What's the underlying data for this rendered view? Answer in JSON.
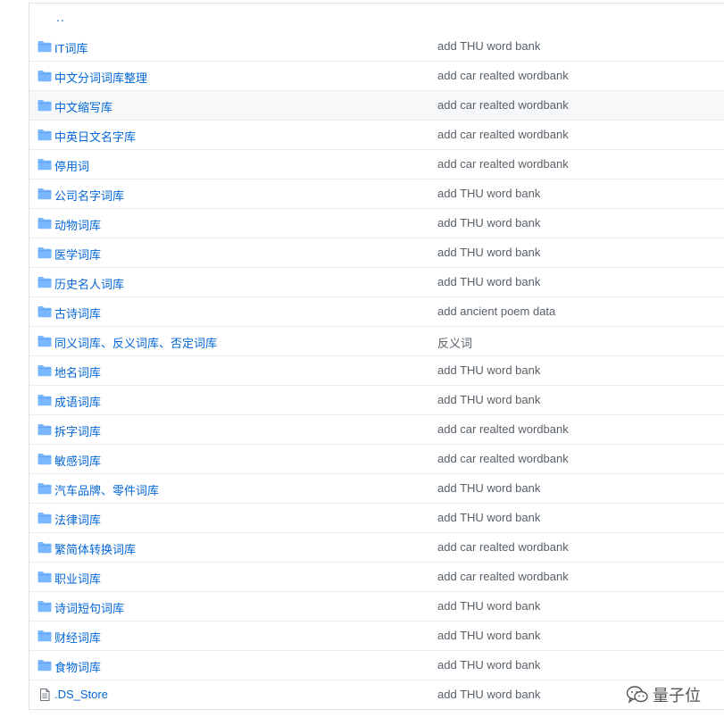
{
  "parent_link": "..",
  "rows": [
    {
      "type": "folder",
      "name": "IT词库",
      "message": "add THU word bank"
    },
    {
      "type": "folder",
      "name": "中文分词词库整理",
      "message": "add car realted wordbank"
    },
    {
      "type": "folder",
      "name": "中文缩写库",
      "message": "add car realted wordbank"
    },
    {
      "type": "folder",
      "name": "中英日文名字库",
      "message": "add car realted wordbank"
    },
    {
      "type": "folder",
      "name": "停用词",
      "message": "add car realted wordbank"
    },
    {
      "type": "folder",
      "name": "公司名字词库",
      "message": "add THU word bank"
    },
    {
      "type": "folder",
      "name": "动物词库",
      "message": "add THU word bank"
    },
    {
      "type": "folder",
      "name": "医学词库",
      "message": "add THU word bank"
    },
    {
      "type": "folder",
      "name": "历史名人词库",
      "message": "add THU word bank"
    },
    {
      "type": "folder",
      "name": "古诗词库",
      "message": "add ancient poem data"
    },
    {
      "type": "folder",
      "name": "同义词库、反义词库、否定词库",
      "message": "反义词"
    },
    {
      "type": "folder",
      "name": "地名词库",
      "message": "add THU word bank"
    },
    {
      "type": "folder",
      "name": "成语词库",
      "message": "add THU word bank"
    },
    {
      "type": "folder",
      "name": "拆字词库",
      "message": "add car realted wordbank"
    },
    {
      "type": "folder",
      "name": "敏感词库",
      "message": "add car realted wordbank"
    },
    {
      "type": "folder",
      "name": "汽车品牌、零件词库",
      "message": "add THU word bank"
    },
    {
      "type": "folder",
      "name": "法律词库",
      "message": "add THU word bank"
    },
    {
      "type": "folder",
      "name": "繁简体转换词库",
      "message": "add car realted wordbank"
    },
    {
      "type": "folder",
      "name": "职业词库",
      "message": "add car realted wordbank"
    },
    {
      "type": "folder",
      "name": "诗词短句词库",
      "message": "add THU word bank"
    },
    {
      "type": "folder",
      "name": "财经词库",
      "message": "add THU word bank"
    },
    {
      "type": "folder",
      "name": "食物词库",
      "message": "add THU word bank"
    },
    {
      "type": "file",
      "name": ".DS_Store",
      "message": "add THU word bank"
    }
  ],
  "hovered_row": "中文缩写库",
  "icons": {
    "folder": "folder-icon",
    "file": "file-icon"
  },
  "colors": {
    "link": "#0366d6",
    "folder": "#79b8ff",
    "muted": "#586069"
  },
  "watermark": {
    "text": "量子位",
    "icon": "wechat-logo-icon"
  }
}
